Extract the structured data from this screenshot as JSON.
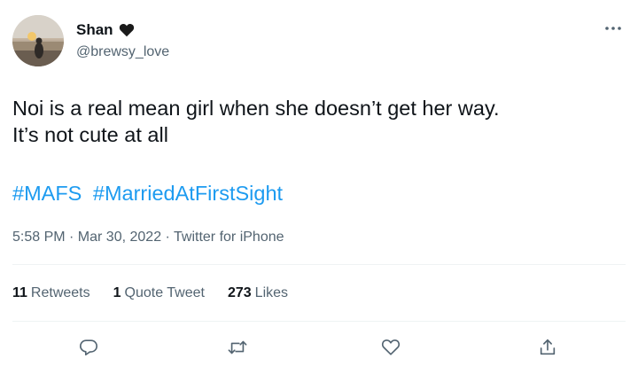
{
  "user": {
    "display_name": "Shan",
    "handle": "@brewsy_love"
  },
  "tweet": {
    "text_line1": "Noi is a real mean girl when she doesn’t get her way.",
    "text_line2": "It’s not cute at all",
    "hashtags": [
      "#MAFS",
      "#MarriedAtFirstSight"
    ],
    "meta": "5:58 PM · Mar 30, 2022 · Twitter for iPhone"
  },
  "stats": {
    "retweets_count": "11",
    "retweets_label": "Retweets",
    "quotes_count": "1",
    "quotes_label": "Quote Tweet",
    "likes_count": "273",
    "likes_label": "Likes"
  },
  "icons": {
    "more": "more-icon",
    "heart_emoji": "heart-icon",
    "reply": "reply-icon",
    "retweet": "retweet-icon",
    "like": "like-icon",
    "share": "share-icon"
  },
  "colors": {
    "hashtag": "#1d9bf0",
    "secondary_text": "#536471",
    "primary_text": "#0f1419"
  }
}
